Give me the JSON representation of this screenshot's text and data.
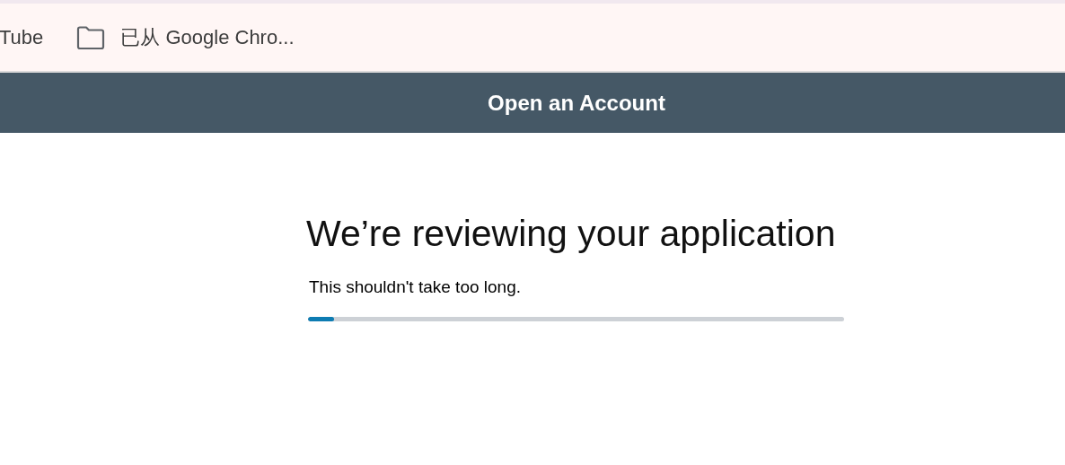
{
  "bookmarks_bar": {
    "items": [
      {
        "label": "Tube",
        "kind": "link"
      },
      {
        "label": "已从 Google Chro...",
        "kind": "folder"
      }
    ]
  },
  "header": {
    "title": "Open an Account"
  },
  "main": {
    "heading": "We’re reviewing your application",
    "message": "This shouldn't take too long.",
    "progress": {
      "level": 0.048
    }
  }
}
